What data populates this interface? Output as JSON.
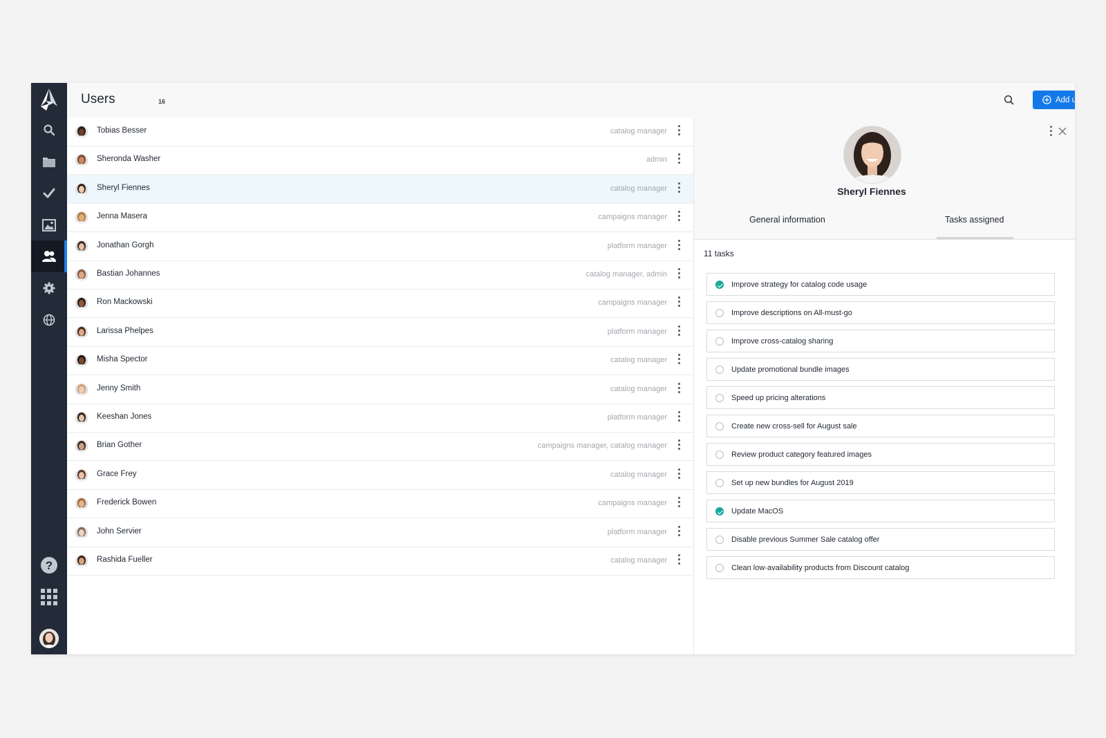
{
  "header": {
    "title": "Users",
    "count": "16",
    "add_button": "Add user"
  },
  "sidebar": {
    "items": [
      {
        "name": "search"
      },
      {
        "name": "folder"
      },
      {
        "name": "tasks"
      },
      {
        "name": "images"
      },
      {
        "name": "users",
        "active": true
      },
      {
        "name": "settings"
      },
      {
        "name": "globe"
      },
      {
        "name": "help"
      },
      {
        "name": "apps"
      }
    ]
  },
  "users": [
    {
      "name": "Tobias Besser",
      "role": "catalog manager"
    },
    {
      "name": "Sheronda Washer",
      "role": "admin"
    },
    {
      "name": "Sheryl Fiennes",
      "role": "catalog manager",
      "selected": true
    },
    {
      "name": "Jenna Masera",
      "role": "campaigns manager"
    },
    {
      "name": "Jonathan Gorgh",
      "role": "platform manager"
    },
    {
      "name": "Bastian Johannes",
      "role": "catalog manager, admin"
    },
    {
      "name": "Ron Mackowski",
      "role": "campaigns manager"
    },
    {
      "name": "Larissa Phelpes",
      "role": "platform manager"
    },
    {
      "name": "Misha Spector",
      "role": "catalog manager"
    },
    {
      "name": "Jenny Smith",
      "role": "catalog manager"
    },
    {
      "name": "Keeshan Jones",
      "role": "platform manager"
    },
    {
      "name": "Brian Gother",
      "role": "campaigns manager, catalog manager"
    },
    {
      "name": "Grace Frey",
      "role": "catalog manager"
    },
    {
      "name": "Frederick Bowen",
      "role": "campaigns manager"
    },
    {
      "name": "John Servier",
      "role": "platform manager"
    },
    {
      "name": "Rashida Fueller",
      "role": "catalog manager"
    }
  ],
  "detail": {
    "name": "Sheryl Fiennes",
    "tabs": [
      "General information",
      "Tasks assigned"
    ],
    "active_tab": "Tasks assigned",
    "tasks_count": "11 tasks",
    "tasks": [
      {
        "label": "Improve strategy for catalog code usage",
        "done": true
      },
      {
        "label": "Improve descriptions on All-must-go",
        "done": false
      },
      {
        "label": "Improve cross-catalog sharing",
        "done": false
      },
      {
        "label": "Update promotional bundle images",
        "done": false
      },
      {
        "label": "Speed up pricing alterations",
        "done": false
      },
      {
        "label": "Create new cross-sell for August sale",
        "done": false
      },
      {
        "label": "Review product category featured images",
        "done": false
      },
      {
        "label": "Set up new bundles for August 2019",
        "done": false
      },
      {
        "label": "Update MacOS",
        "done": true
      },
      {
        "label": "Disable previous Summer Sale catalog offer",
        "done": false
      },
      {
        "label": "Clean low-availability products from Discount catalog",
        "done": false
      }
    ]
  },
  "colors": {
    "sidebar": "#232b38",
    "accent": "#1479e8",
    "done": "#1aa89c",
    "selected_row": "#edf7fc"
  }
}
